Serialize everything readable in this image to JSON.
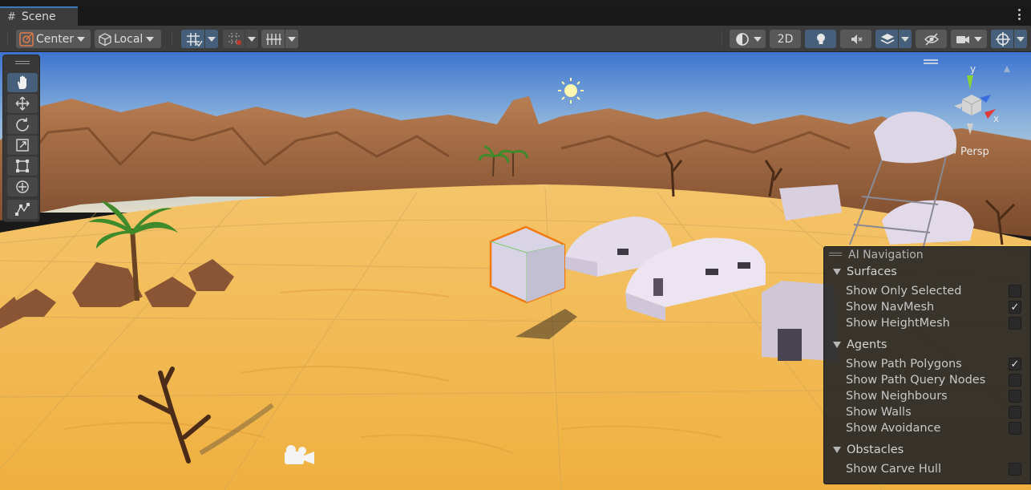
{
  "tab": {
    "icon": "grid-hash-icon",
    "label": "Scene"
  },
  "toolbar": {
    "pivot_mode": "Center",
    "pivot_rotation": "Local",
    "mode_2d": "2D"
  },
  "tools": [
    "hand-tool-icon",
    "move-tool-icon",
    "rotate-tool-icon",
    "scale-tool-icon",
    "rect-tool-icon",
    "transform-tool-icon",
    "custom-editor-tool-icon"
  ],
  "gizmo": {
    "y_label": "y",
    "x_label": "x",
    "projection": "Persp"
  },
  "ai_navigation": {
    "title": "AI Navigation",
    "surfaces": {
      "label": "Surfaces",
      "options": [
        {
          "label": "Show Only Selected",
          "checked": false
        },
        {
          "label": "Show NavMesh",
          "checked": true
        },
        {
          "label": "Show HeightMesh",
          "checked": false
        }
      ]
    },
    "agents": {
      "label": "Agents",
      "options": [
        {
          "label": "Show Path Polygons",
          "checked": true
        },
        {
          "label": "Show Path Query Nodes",
          "checked": false
        },
        {
          "label": "Show Neighbours",
          "checked": false
        },
        {
          "label": "Show Walls",
          "checked": false
        },
        {
          "label": "Show Avoidance",
          "checked": false
        }
      ]
    },
    "obstacles": {
      "label": "Obstacles",
      "options": [
        {
          "label": "Show Carve Hull",
          "checked": false
        }
      ]
    }
  },
  "colors": {
    "selection_outline": "#f07a10",
    "accent": "#3a79bb",
    "pressed": "#46607c"
  }
}
